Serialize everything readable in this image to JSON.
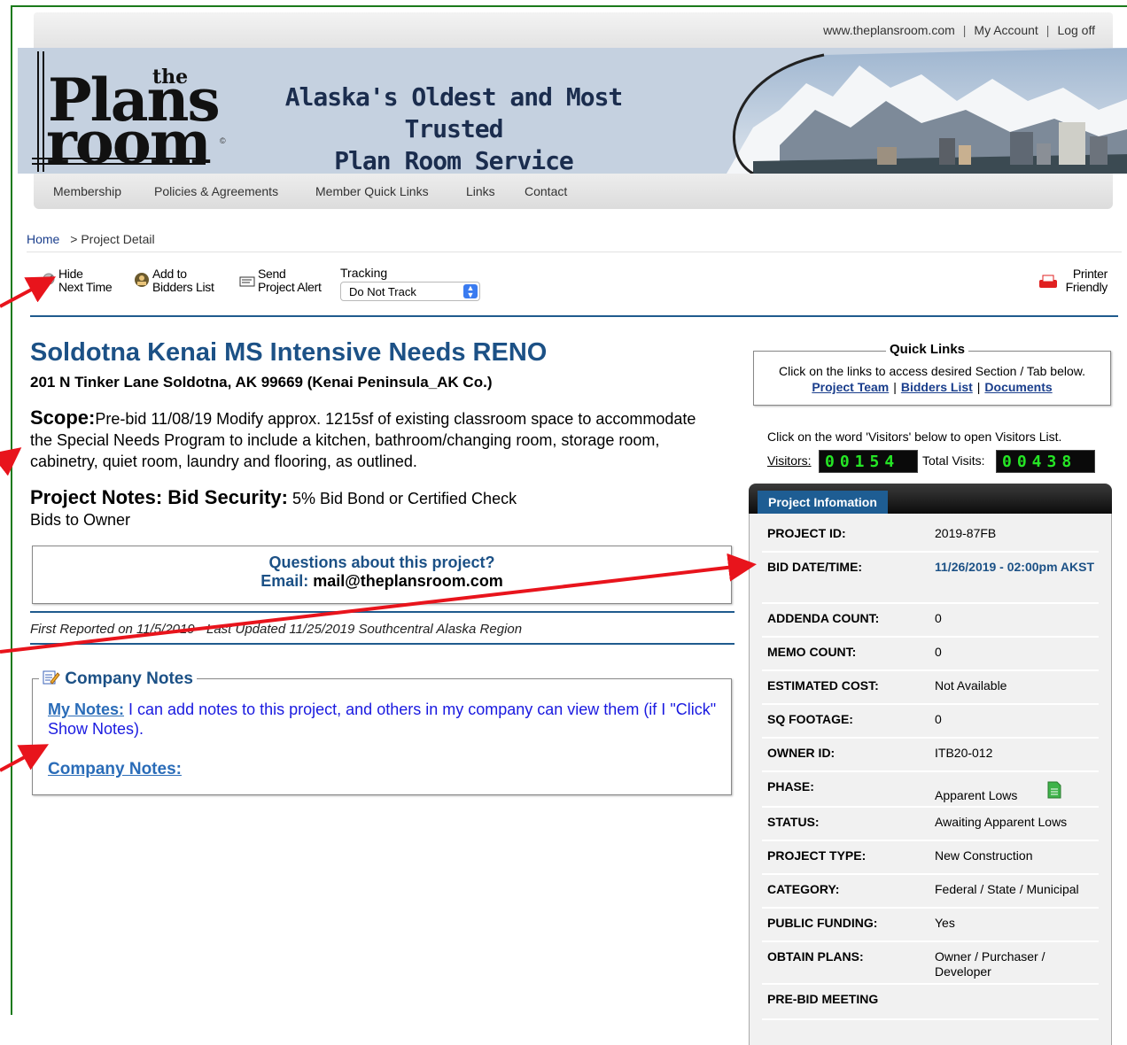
{
  "top_links": [
    "www.theplansroom.com",
    "My Account",
    "Log off"
  ],
  "logo": {
    "the": "the",
    "plans": "Plans",
    "room": "room",
    "copyright": "©"
  },
  "tagline": [
    "Alaska's Oldest and Most Trusted",
    "Plan Room Service"
  ],
  "nav": [
    "Membership",
    "Policies & Agreements",
    "Member Quick Links",
    "Links",
    "Contact"
  ],
  "breadcrumb": {
    "home": "Home",
    "current": "> Project Detail"
  },
  "toolbar": {
    "hide": [
      "Hide",
      "Next Time"
    ],
    "add": [
      "Add to",
      "Bidders List"
    ],
    "send": [
      "Send",
      "Project Alert"
    ],
    "tracking_label": "Tracking",
    "tracking_value": "Do Not Track",
    "printer": [
      "Printer",
      "Friendly"
    ]
  },
  "project": {
    "title": "Soldotna Kenai MS Intensive Needs RENO",
    "address": "201 N Tinker Lane Soldotna, AK 99669 (Kenai Peninsula_AK Co.)",
    "scope_label": "Scope:",
    "scope_text": "Pre-bid 11/08/19 Modify approx. 1215sf of existing classroom space to accommodate the Special Needs Program to include a kitchen, bathroom/changing room, storage room, cabinetry, quiet room, laundry and flooring, as outlined.",
    "notes_label": "Project Notes: Bid Security:",
    "notes_text": " 5% Bid Bond or Certified Check",
    "notes_line2": "Bids to Owner",
    "questions": "Questions about this project?",
    "email_label": "Email: ",
    "email": "mail@theplansroom.com",
    "reported": "First Reported on 11/5/2019 - Last Updated 11/25/2019    Southcentral Alaska Region"
  },
  "company_notes": {
    "legend": "Company Notes",
    "my_notes_label": "My Notes:",
    "my_notes_text": "  I can add notes to this project, and others in my company can view them (if I \"Click\" Show Notes).",
    "company_label": "Company Notes:"
  },
  "quick_links": {
    "legend": "Quick Links",
    "desc": "Click on the links to access desired Section / Tab below.",
    "links": [
      "Project Team",
      "Bidders List",
      "Documents"
    ]
  },
  "visitors": {
    "note": "Click on the word 'Visitors' below to open Visitors List.",
    "label": "Visitors:",
    "count": "00154",
    "total_label": "Total Visits:",
    "total": "00438"
  },
  "project_info": {
    "tab": "Project Infomation",
    "rows": [
      {
        "k": "PROJECT ID:",
        "v": "2019-87FB"
      },
      {
        "k": "BID DATE/TIME:",
        "v": "11/26/2019 - 02:00pm AKST"
      },
      {
        "k": "ADDENDA COUNT:",
        "v": "0"
      },
      {
        "k": "MEMO COUNT:",
        "v": "0"
      },
      {
        "k": "ESTIMATED COST:",
        "v": "Not Available"
      },
      {
        "k": "SQ FOOTAGE:",
        "v": "0"
      },
      {
        "k": "OWNER ID:",
        "v": "ITB20-012"
      },
      {
        "k": "PHASE:",
        "v": "Apparent Lows"
      },
      {
        "k": "STATUS:",
        "v": "Awaiting Apparent Lows"
      },
      {
        "k": "PROJECT TYPE:",
        "v": "New Construction"
      },
      {
        "k": "CATEGORY:",
        "v": "Federal / State / Municipal"
      },
      {
        "k": "PUBLIC FUNDING:",
        "v": "Yes"
      },
      {
        "k": "OBTAIN PLANS:",
        "v": "Owner / Purchaser / Developer"
      },
      {
        "k": "PRE-BID MEETING",
        "v": ""
      }
    ]
  },
  "colors": {
    "accent_blue": "#1c5186",
    "counter_green": "#25e525",
    "arrow_red": "#e8141c",
    "frame_green": "#1b7a1b"
  }
}
